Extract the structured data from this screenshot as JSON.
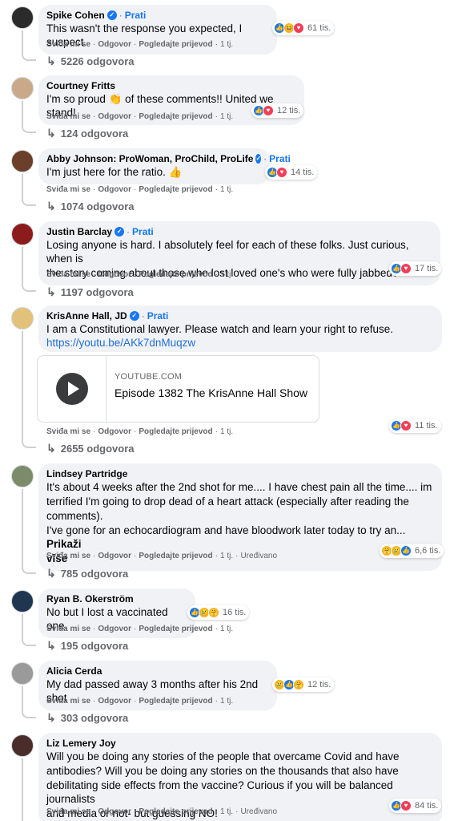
{
  "labels": {
    "like": "Sviđa mi se",
    "reply": "Odgovor",
    "translate": "Pogledajte prijevod",
    "sep": "·",
    "follow": "Prati",
    "edited": "Uređivano",
    "see_more": "Prikaži više"
  },
  "colors": {
    "link": "#216fdb",
    "brand": "#1877f2",
    "bubble": "#f0f2f5",
    "meta": "#65676b"
  },
  "comments": [
    {
      "author": "Spike Cohen",
      "verified": true,
      "follow": true,
      "text": "This wasn't the response you expected, I suspect.",
      "reactions": [
        "like-icon",
        "haha-icon",
        "love-icon"
      ],
      "reaction_count": "61 tis.",
      "time": "1 tj.",
      "replies": "5226 odgovora"
    },
    {
      "author": "Courtney Fritts",
      "verified": false,
      "follow": false,
      "text": "I'm so proud 👏 of these comments!! United we stand!",
      "reactions": [
        "like-icon",
        "love-icon"
      ],
      "reaction_count": "12 tis.",
      "time": "1 tj.",
      "replies": "124 odgovora"
    },
    {
      "author": "Abby Johnson: ProWoman, ProChild, ProLife",
      "verified": true,
      "follow": true,
      "text": "I'm just here for the ratio. 👍",
      "reactions": [
        "like-icon",
        "love-icon"
      ],
      "reaction_count": "14 tis.",
      "time": "1 tj.",
      "replies": "1074 odgovora"
    },
    {
      "author": "Justin Barclay",
      "verified": true,
      "follow": true,
      "text_lines": [
        "Losing anyone is hard. I absolutely feel for each of these folks. Just curious, when is",
        "the story coming about those who lost loved one's who were fully jabbed?"
      ],
      "reactions": [
        "like-icon",
        "love-icon"
      ],
      "reaction_count": "17 tis.",
      "time": "1 tj.",
      "replies": "1197 odgovora"
    },
    {
      "author": "KrisAnne Hall, JD",
      "verified": true,
      "follow": true,
      "text": "I am a Constitutional lawyer. Please watch and learn your right to refuse.",
      "link": "https://youtu.be/AKk7dnMuqzw",
      "card": {
        "domain": "YOUTUBE.COM",
        "title": "Episode 1382 The KrisAnne Hall Show"
      },
      "reactions": [
        "like-icon",
        "love-icon"
      ],
      "reaction_count": "11 tis.",
      "time": "1 tj.",
      "replies": "2655 odgovora"
    },
    {
      "author": "Lindsey Partridge",
      "verified": false,
      "follow": false,
      "text_lines": [
        "It's about 4 weeks after the 2nd shot for me.... I have chest pain all the time.... im",
        "terrified I'm going to drop dead of a heart attack (especially after reading the",
        "comments).",
        "I've gone for an echocardiogram and have bloodwork later today to try an..."
      ],
      "see_more_line_1": "Prikaži",
      "see_more_line_2": "više",
      "reactions": [
        "care-icon",
        "sad-icon",
        "like-icon"
      ],
      "reaction_count": "6,6 tis.",
      "time": "1 tj.",
      "edited": true,
      "replies": "785 odgovora"
    },
    {
      "author": "Ryan B. Okerström",
      "verified": false,
      "follow": false,
      "text": "No but I lost a vaccinated one.",
      "reactions": [
        "like-icon",
        "sad-icon",
        "care-icon"
      ],
      "reaction_count": "16 tis.",
      "time": "1 tj.",
      "replies": "195 odgovora"
    },
    {
      "author": "Alicia Cerda",
      "verified": false,
      "follow": false,
      "text": "My dad passed away 3 months after his 2nd shot",
      "reactions": [
        "sad-icon",
        "like-icon",
        "care-icon"
      ],
      "reaction_count": "12 tis.",
      "time": "1 tj.",
      "replies": "303 odgovora"
    },
    {
      "author": "Liz Lemery Joy",
      "verified": false,
      "follow": false,
      "text_lines": [
        "Will you be doing any stories of the people that overcame Covid and have",
        "antibodies? Will you be doing any stories on the thousands that also have",
        "debilitating side effects from the vaccine? Curious if you will be balanced journalists",
        "and media or not- but guessing NO!"
      ],
      "reactions": [
        "like-icon",
        "love-icon"
      ],
      "reaction_count": "84 tis.",
      "time": "1 tj.",
      "edited": true
    }
  ]
}
